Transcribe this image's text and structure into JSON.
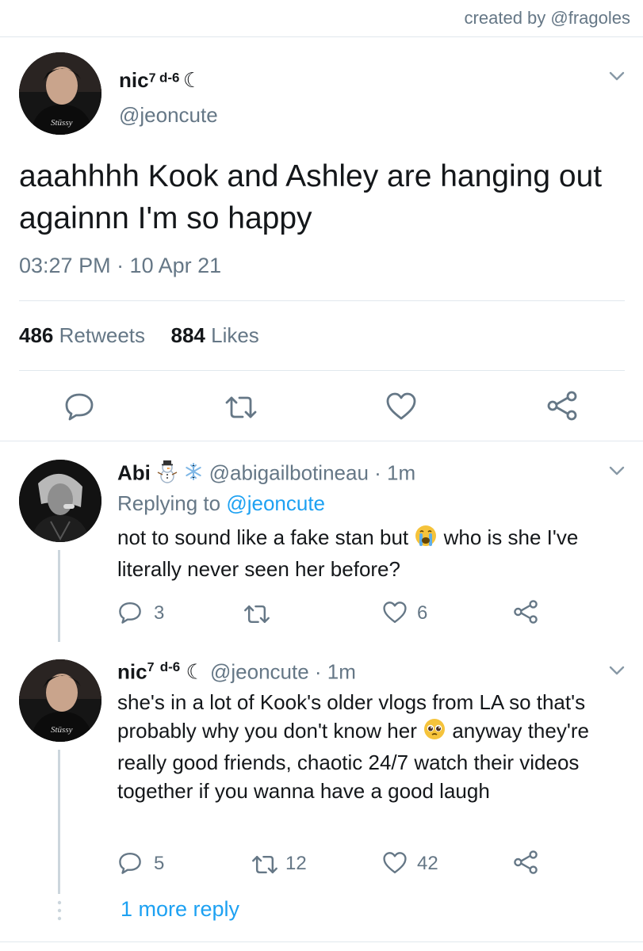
{
  "credit": "created by @fragoles",
  "main_tweet": {
    "name": "nic",
    "name_sup": "7",
    "name_suffix": "d-6",
    "moon": "☾",
    "handle": "@jeoncute",
    "text": "aaahhhh Kook and Ashley are hanging out againnn I'm so happy",
    "time": "03:27 PM · 10 Apr 21",
    "retweets_count": "486",
    "retweets_label": "Retweets",
    "likes_count": "884",
    "likes_label": "Likes"
  },
  "replies": [
    {
      "name": "Abi",
      "handle_time": "@abigailbotineau · 1m",
      "replying_prefix": "Replying to ",
      "replying_handle": "@jeoncute",
      "text_part1": "not to sound like a fake stan but",
      "text_part2": "who is she I've literally never seen her before?",
      "reply_count": "3",
      "like_count": "6",
      "emojis": [
        "snowman-emoji",
        "snowflake-emoji",
        "crying-face-emoji"
      ]
    },
    {
      "name": "nic",
      "name_sup": "7",
      "name_suffix": "d-6",
      "moon": "☾",
      "handle_time": "@jeoncute · 1m",
      "text_part1": "she's in a lot of Kook's older vlogs from LA so that's probably why you don't know her",
      "text_part2": "anyway they're really good friends, chaotic 24/7 watch their videos together if you wanna have a good laugh",
      "reply_count": "5",
      "retweet_count": "12",
      "like_count": "42",
      "emojis": [
        "pleading-face-emoji"
      ]
    }
  ],
  "more_replies": "1 more reply",
  "colors": {
    "link": "#1da1f2",
    "secondary_text": "#657786",
    "divider": "#e1e8ed"
  }
}
